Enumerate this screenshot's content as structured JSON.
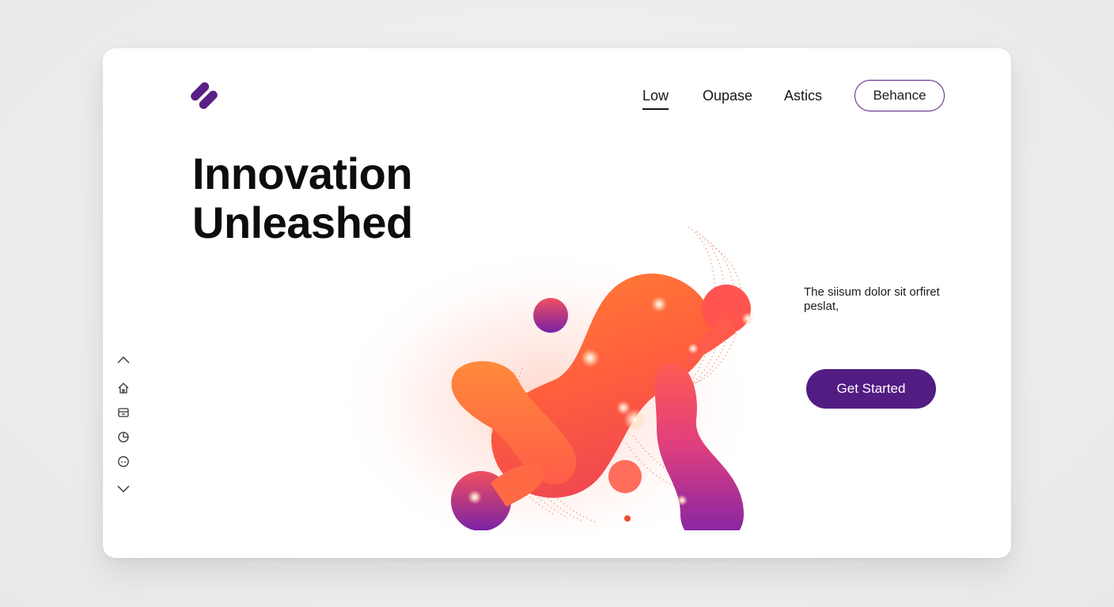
{
  "brand": {
    "logo_icon": "pill-pair-logo-icon",
    "logo_color": "#5a1f86"
  },
  "nav": {
    "items": [
      {
        "label": "Low",
        "active": true
      },
      {
        "label": "Oupase",
        "active": false
      },
      {
        "label": "Astics",
        "active": false
      }
    ],
    "cta_label": "Behance"
  },
  "hero": {
    "title_line1": "Innovation",
    "title_line2": "Unleashed",
    "description": "The siisum dolor sit orfiret peslat,",
    "primary_button": "Get Started"
  },
  "sidebar": {
    "icons": [
      "chevron-up-icon",
      "home-icon",
      "archive-icon",
      "pie-chart-icon",
      "face-icon",
      "chevron-down-icon"
    ]
  },
  "colors": {
    "accent": "#531c83",
    "gradient_orange": "#ff7a2f",
    "gradient_pink": "#f04a6a",
    "gradient_purple": "#7a1fa8"
  }
}
